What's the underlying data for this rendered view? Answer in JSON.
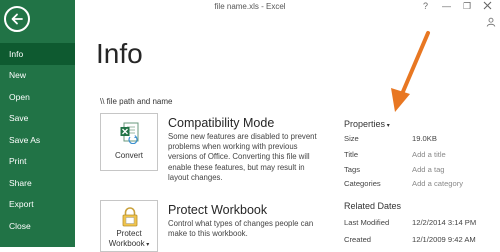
{
  "window": {
    "title": "file name.xls - Excel",
    "help": "?",
    "minimize": "—",
    "restore": "❐"
  },
  "sidebar": {
    "items": [
      {
        "label": "Info",
        "active": true
      },
      {
        "label": "New"
      },
      {
        "label": "Open"
      },
      {
        "label": "Save"
      },
      {
        "label": "Save As"
      },
      {
        "label": "Print"
      },
      {
        "label": "Share"
      },
      {
        "label": "Export"
      },
      {
        "label": "Close"
      }
    ]
  },
  "main": {
    "page_title": "Info",
    "file_path": "\\\\ file path and name",
    "compat": {
      "button_label": "Convert",
      "title": "Compatibility Mode",
      "description": "Some new features are disabled to prevent problems when working with previous versions of Office. Converting this file will enable these features, but may result in layout changes."
    },
    "protect": {
      "button_line1": "Protect",
      "button_line2": "Workbook",
      "title": "Protect Workbook",
      "description": "Control what types of changes people can make to this workbook."
    }
  },
  "properties": {
    "heading": "Properties",
    "rows": [
      {
        "label": "Size",
        "value": "19.0KB"
      },
      {
        "label": "Title",
        "value": "Add a title"
      },
      {
        "label": "Tags",
        "value": "Add a tag"
      },
      {
        "label": "Categories",
        "value": "Add a category"
      }
    ]
  },
  "related_dates": {
    "heading": "Related Dates",
    "rows": [
      {
        "label": "Last Modified",
        "value": "12/2/2014 3:14 PM"
      },
      {
        "label": "Created",
        "value": "12/1/2009 9:42 AM"
      }
    ]
  },
  "colors": {
    "sidebar_bg": "#217346",
    "sidebar_active": "#0e5a30",
    "annotation_arrow": "#e87722"
  }
}
